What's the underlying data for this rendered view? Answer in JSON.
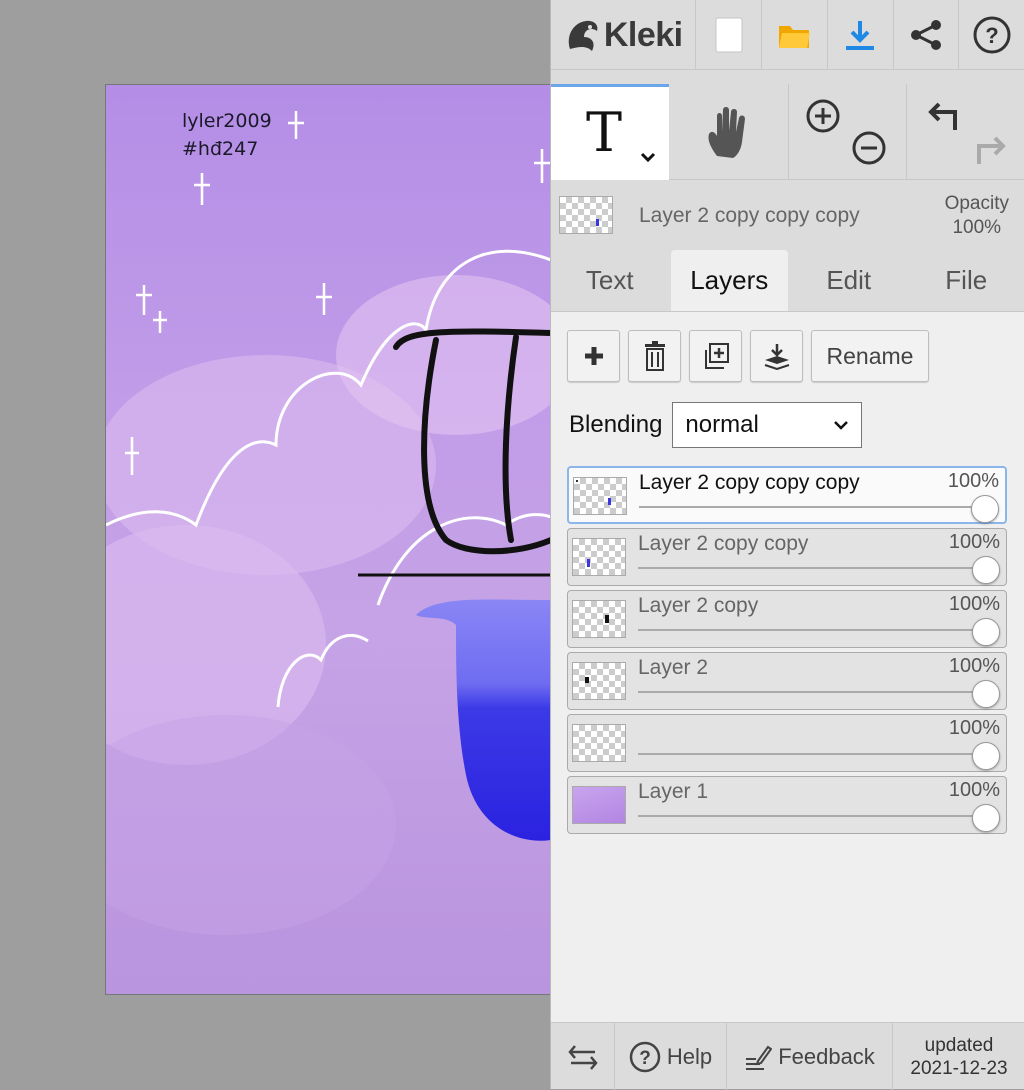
{
  "canvas": {
    "watermark_line1": "lyler2009",
    "watermark_line2": "#hđ247"
  },
  "app": {
    "name": "Kleki"
  },
  "toolbar_icons": [
    "new-image-icon",
    "open-folder-icon",
    "download-icon",
    "share-icon",
    "help-icon"
  ],
  "current_layer": {
    "name": "Layer 2 copy copy copy",
    "opacity_label": "Opacity",
    "opacity_value": "100%"
  },
  "tabs": [
    "Text",
    "Layers",
    "Edit",
    "File"
  ],
  "active_tab": "Layers",
  "layer_buttons": {
    "rename_label": "Rename"
  },
  "blending": {
    "label": "Blending",
    "value": "normal"
  },
  "layers": [
    {
      "name": "Layer 2 copy copy copy",
      "opacity": "100%",
      "selected": true
    },
    {
      "name": "Layer 2 copy copy",
      "opacity": "100%",
      "selected": false
    },
    {
      "name": "Layer 2 copy",
      "opacity": "100%",
      "selected": false
    },
    {
      "name": "Layer 2",
      "opacity": "100%",
      "selected": false
    },
    {
      "name": "",
      "opacity": "100%",
      "selected": false
    },
    {
      "name": "Layer 1",
      "opacity": "100%",
      "selected": false
    }
  ],
  "footer": {
    "help_label": "Help",
    "feedback_label": "Feedback",
    "updated_label": "updated",
    "updated_date": "2021-12-23"
  },
  "colors": {
    "panel_bg": "#dcdcdc",
    "accent_blue": "#6aa6e8",
    "download_blue": "#1e88e5",
    "folder_yellow": "#f5b400"
  }
}
